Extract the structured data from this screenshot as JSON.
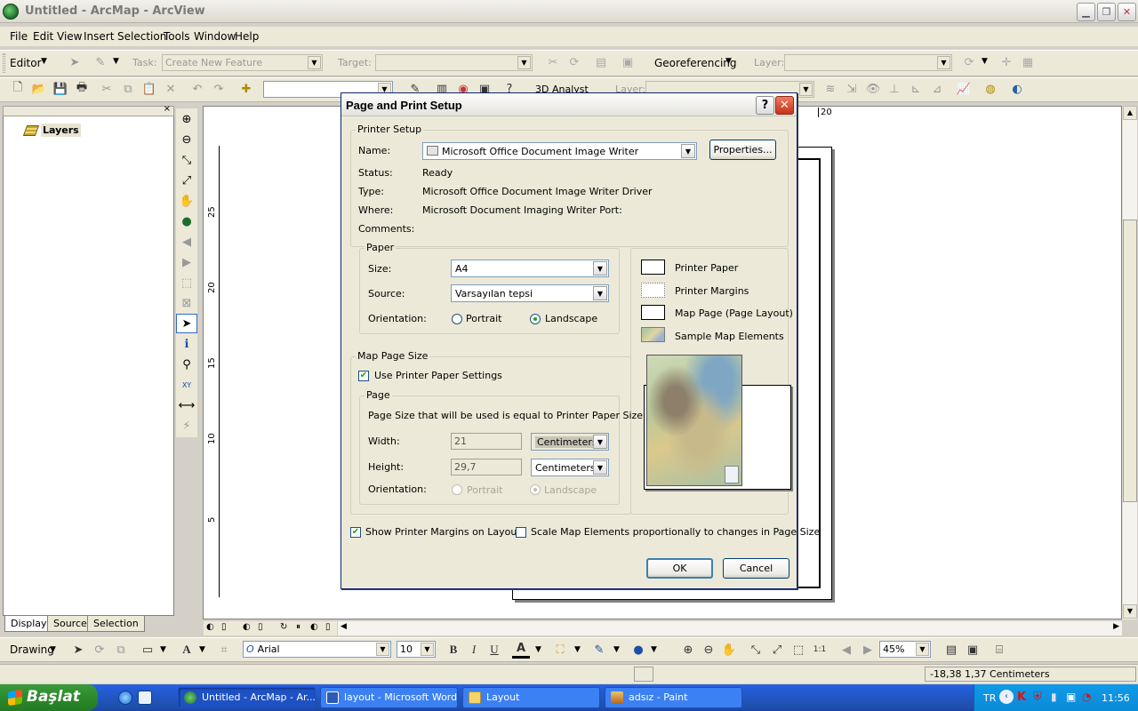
{
  "window": {
    "title": "Untitled - ArcMap - ArcView"
  },
  "menu": [
    "File",
    "Edit",
    "View",
    "Insert",
    "Selection",
    "Tools",
    "Window",
    "Help"
  ],
  "editor_toolbar": {
    "editor_label": "Editor",
    "task_label": "Task:",
    "task_value": "Create New Feature",
    "target_label": "Target:",
    "georef_label": "Georeferencing",
    "layer_label": "Layer:"
  },
  "standard_toolbar": {
    "analyst_label": "3D Analyst",
    "layer_label": "Layer:"
  },
  "toc": {
    "root": "Layers",
    "tabs": [
      "Display",
      "Source",
      "Selection"
    ]
  },
  "ruler": {
    "v_ticks": [
      "25",
      "20",
      "15",
      "10",
      "5"
    ],
    "h_tick": "20"
  },
  "dialog": {
    "title": "Page and Print Setup",
    "printer_setup": {
      "group": "Printer Setup",
      "name_label": "Name:",
      "name_value": "Microsoft Office Document Image Writer",
      "properties_btn": "Properties...",
      "status_label": "Status:",
      "status_value": "Ready",
      "type_label": "Type:",
      "type_value": "Microsoft Office Document Image Writer Driver",
      "where_label": "Where:",
      "where_value": "Microsoft Document Imaging Writer Port:",
      "comments_label": "Comments:"
    },
    "paper": {
      "group": "Paper",
      "size_label": "Size:",
      "size_value": "A4",
      "source_label": "Source:",
      "source_value": "Varsayılan tepsi",
      "orientation_label": "Orientation:",
      "portrait": "Portrait",
      "landscape": "Landscape"
    },
    "legend": [
      "Printer Paper",
      "Printer Margins",
      "Map Page (Page Layout)",
      "Sample Map Elements"
    ],
    "map_page_size": {
      "group": "Map Page Size",
      "use_printer": "Use Printer Paper Settings",
      "page_group": "Page",
      "note": "Page Size that will be used is equal to Printer Paper Size",
      "width_label": "Width:",
      "width_value": "21",
      "height_label": "Height:",
      "height_value": "29,7",
      "units": "Centimeters",
      "orientation_label": "Orientation:",
      "portrait": "Portrait",
      "landscape": "Landscape"
    },
    "show_margins": "Show Printer Margins on Layout",
    "scale_elements": "Scale Map Elements proportionally to changes in Page Size",
    "ok": "OK",
    "cancel": "Cancel"
  },
  "draw_toolbar": {
    "drawing_label": "Drawing",
    "font": "Arial",
    "font_size": "10",
    "zoom": "45%"
  },
  "status": {
    "coords": "-18,38  1,37 Centimeters"
  },
  "taskbar": {
    "start": "Başlat",
    "tasks": [
      "Untitled - ArcMap - Ar...",
      "layout - Microsoft Word",
      "Layout",
      "adsız - Paint"
    ],
    "lang": "TR",
    "clock": "11:56"
  }
}
